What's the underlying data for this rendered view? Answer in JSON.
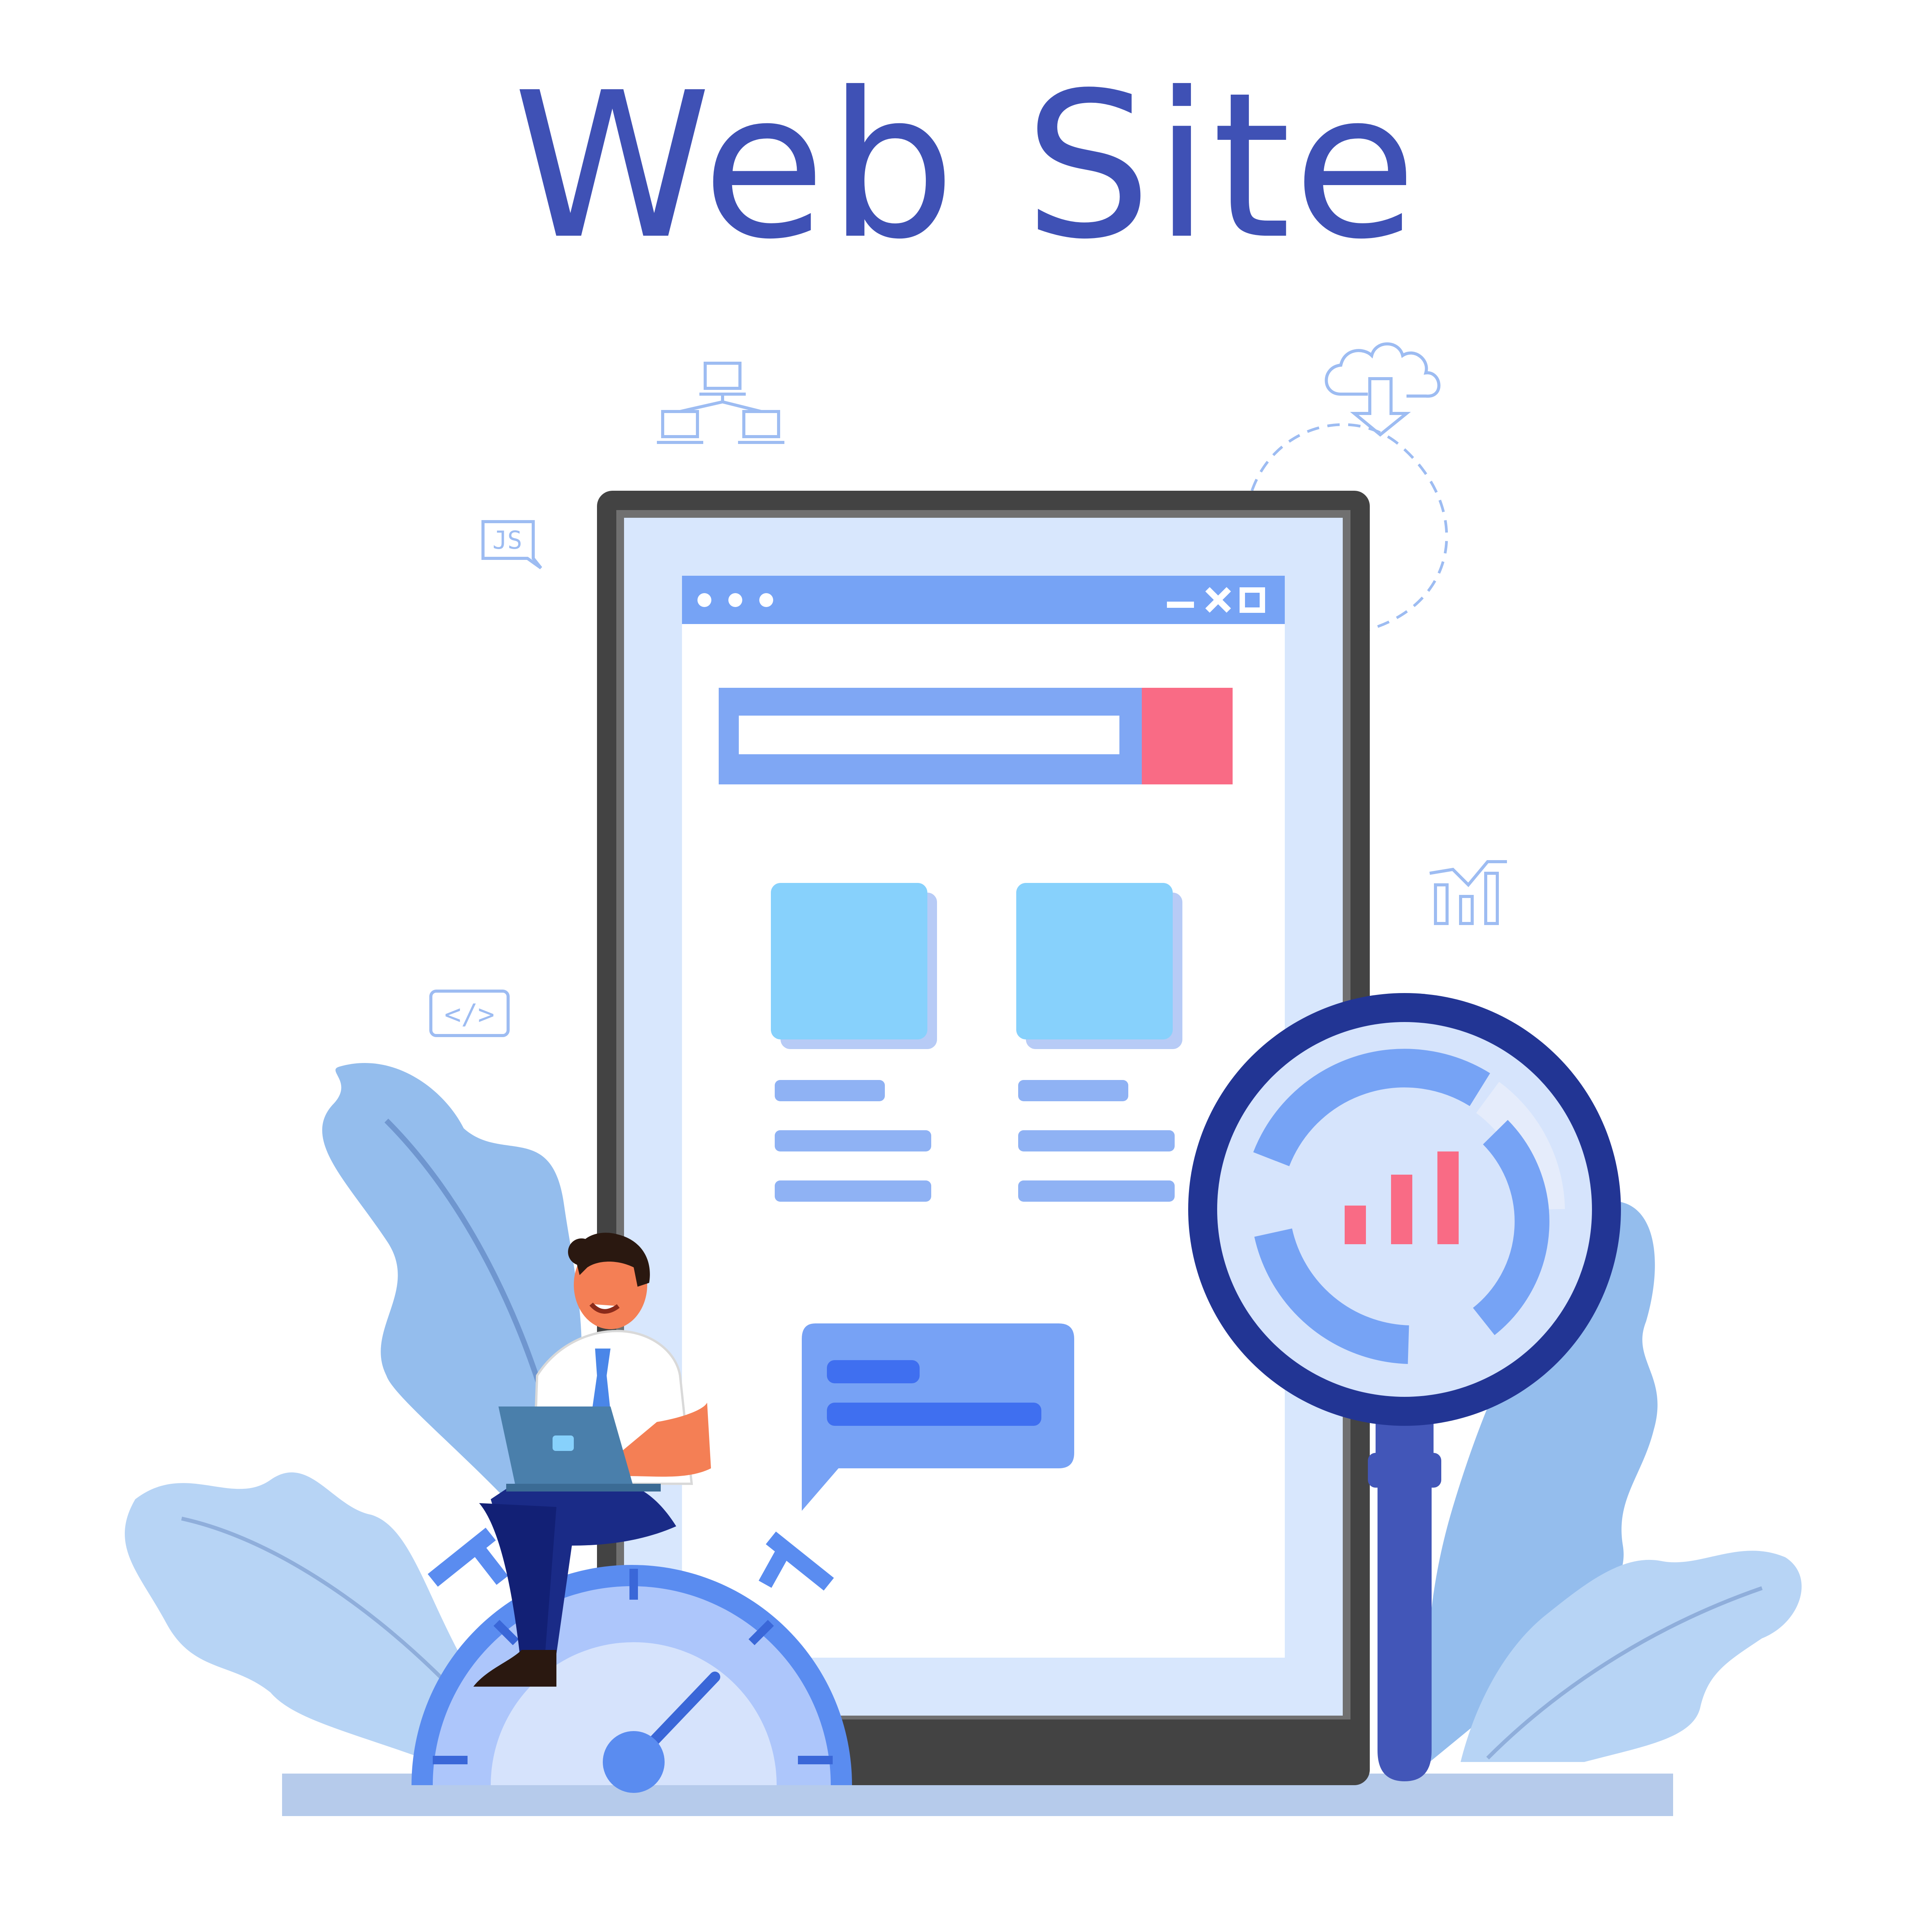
{
  "title": "Web Site",
  "icons": {
    "network": "network-icon",
    "cloud_download": "cloud-download-icon",
    "js_file": "js-icon",
    "code_tag": "code-tag-icon",
    "analytics": "bar-chart-icon",
    "window_dots": "window-dots-icon",
    "window_controls": "window-controls-icon",
    "magnifier": "magnifier-icon",
    "stopwatch": "stopwatch-icon",
    "laptop": "laptop-icon"
  },
  "labels": {
    "js": "JS",
    "code": "</>"
  },
  "colors": {
    "title": "#3f51b5",
    "device_frame": "#434343",
    "device_screen": "#d8e7fd",
    "browser_bar": "#76a3f5",
    "search_button": "#f96b85",
    "card": "#87d1fc",
    "text_lines": "#8fb2f4",
    "chat_bubble": "#77a2f5",
    "chat_lines": "#3f6ff0",
    "magnifier_ring": "#223594",
    "magnifier_handle": "#4256b8",
    "leaves": "#94bded",
    "leaves_light": "#b7d4f5",
    "stopwatch": "#5a8cf0",
    "floor": "#b6cbeb"
  }
}
